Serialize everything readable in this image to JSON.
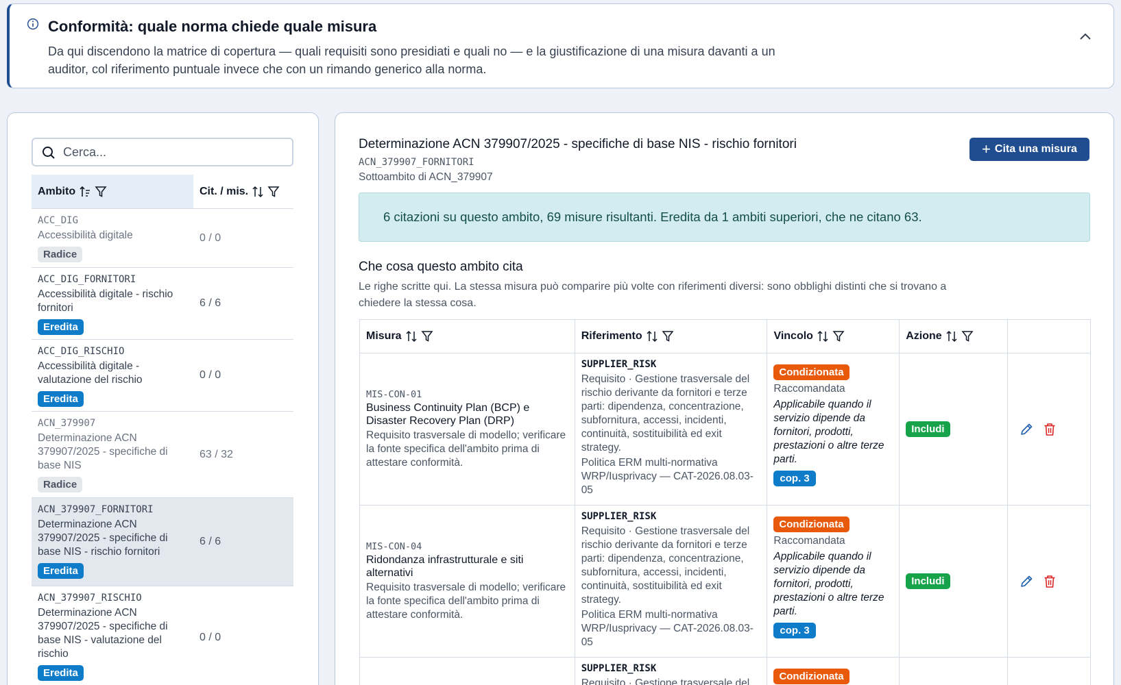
{
  "banner": {
    "title": "Conformità: quale norma chiede quale misura",
    "description": "Da qui discendono la matrice di copertura — quali requisiti sono presidiati e quali no — e la giustificazione di una misura davanti a un auditor, col riferimento puntuale invece che con un rimando generico alla norma."
  },
  "sidebar": {
    "search_placeholder": "Cerca...",
    "headers": {
      "scope": "Ambito",
      "counts": "Cit. / mis."
    },
    "rows": [
      {
        "code": "ACC_DIG",
        "name": "Accessibilità digitale",
        "counts": "0 / 0",
        "badge": "Radice"
      },
      {
        "code": "ACC_DIG_FORNITORI",
        "name": "Accessibilità digitale - rischio fornitori",
        "counts": "6 / 6",
        "badge": "Eredita"
      },
      {
        "code": "ACC_DIG_RISCHIO",
        "name": "Accessibilità digitale - valutazione del rischio",
        "counts": "0 / 0",
        "badge": "Eredita"
      },
      {
        "code": "ACN_379907",
        "name": "Determinazione ACN 379907/2025 - specifiche di base NIS",
        "counts": "63 / 32",
        "badge": "Radice"
      },
      {
        "code": "ACN_379907_FORNITORI",
        "name": "Determinazione ACN 379907/2025 - specifiche di base NIS - rischio fornitori",
        "counts": "6 / 6",
        "badge": "Eredita"
      },
      {
        "code": "ACN_379907_RISCHIO",
        "name": "Determinazione ACN 379907/2025 - specifiche di base NIS - valutazione del rischio",
        "counts": "0 / 0",
        "badge": "Eredita"
      }
    ]
  },
  "detail": {
    "title": "Determinazione ACN 379907/2025 - specifiche di base NIS - rischio fornitori",
    "code": "ACN_379907_FORNITORI",
    "parent": "Sottoambito di ACN_379907",
    "cite_button": "Cita una misura",
    "alert": "6 citazioni su questo ambito, 69 misure risultanti. Eredita da 1 ambiti superiori, che ne citano 63.",
    "section_title": "Che cosa questo ambito cita",
    "section_desc": "Le righe scritte qui. La stessa misura può comparire più volte con riferimenti diversi: sono obblighi distinti che si trovano a chiedere la stessa cosa.",
    "headers": {
      "measure": "Misura",
      "reference": "Riferimento",
      "constraint": "Vincolo",
      "action": "Azione"
    },
    "rows": [
      {
        "code": "MIS-CON-01",
        "name": "Business Continuity Plan (BCP) e Disaster Recovery Plan (DRP)",
        "desc": "Requisito trasversale di modello; verificare la fonte specifica dell'ambito prima di attestare conformità.",
        "ref_key": "SUPPLIER_RISK",
        "ref_text": "Requisito · Gestione trasversale del rischio derivante da fornitori e terze parti: dipendenza, concentrazione, subfornitura, accessi, incidenti, continuità, sostituibilità ed exit strategy.",
        "ref_src": "Politica ERM multi-normativa WRP/Iusprivacy — CAT-2026.08.03-05",
        "constraint": "Condizionata",
        "level": "Raccomandata",
        "note": "Applicabile quando il servizio dipende da fornitori, prodotti, prestazioni o altre terze parti.",
        "coverage": "cop. 3",
        "action": "Includi"
      },
      {
        "code": "MIS-CON-04",
        "name": "Ridondanza infrastrutturale e siti alternativi",
        "desc": "Requisito trasversale di modello; verificare la fonte specifica dell'ambito prima di attestare conformità.",
        "ref_key": "SUPPLIER_RISK",
        "ref_text": "Requisito · Gestione trasversale del rischio derivante da fornitori e terze parti: dipendenza, concentrazione, subfornitura, accessi, incidenti, continuità, sostituibilità ed exit strategy.",
        "ref_src": "Politica ERM multi-normativa WRP/Iusprivacy — CAT-2026.08.03-05",
        "constraint": "Condizionata",
        "level": "Raccomandata",
        "note": "Applicabile quando il servizio dipende da fornitori, prodotti, prestazioni o altre terze parti.",
        "coverage": "cop. 3",
        "action": "Includi"
      },
      {
        "ref_key": "SUPPLIER_RISK",
        "ref_text": "Requisito · Gestione trasversale del",
        "constraint": "Condizionata"
      }
    ]
  },
  "colors": {
    "primary": "#1f4d8f",
    "inherit": "#0f7cc9",
    "conditional": "#e8590c",
    "include": "#16a34a",
    "delete": "#dc2626"
  }
}
